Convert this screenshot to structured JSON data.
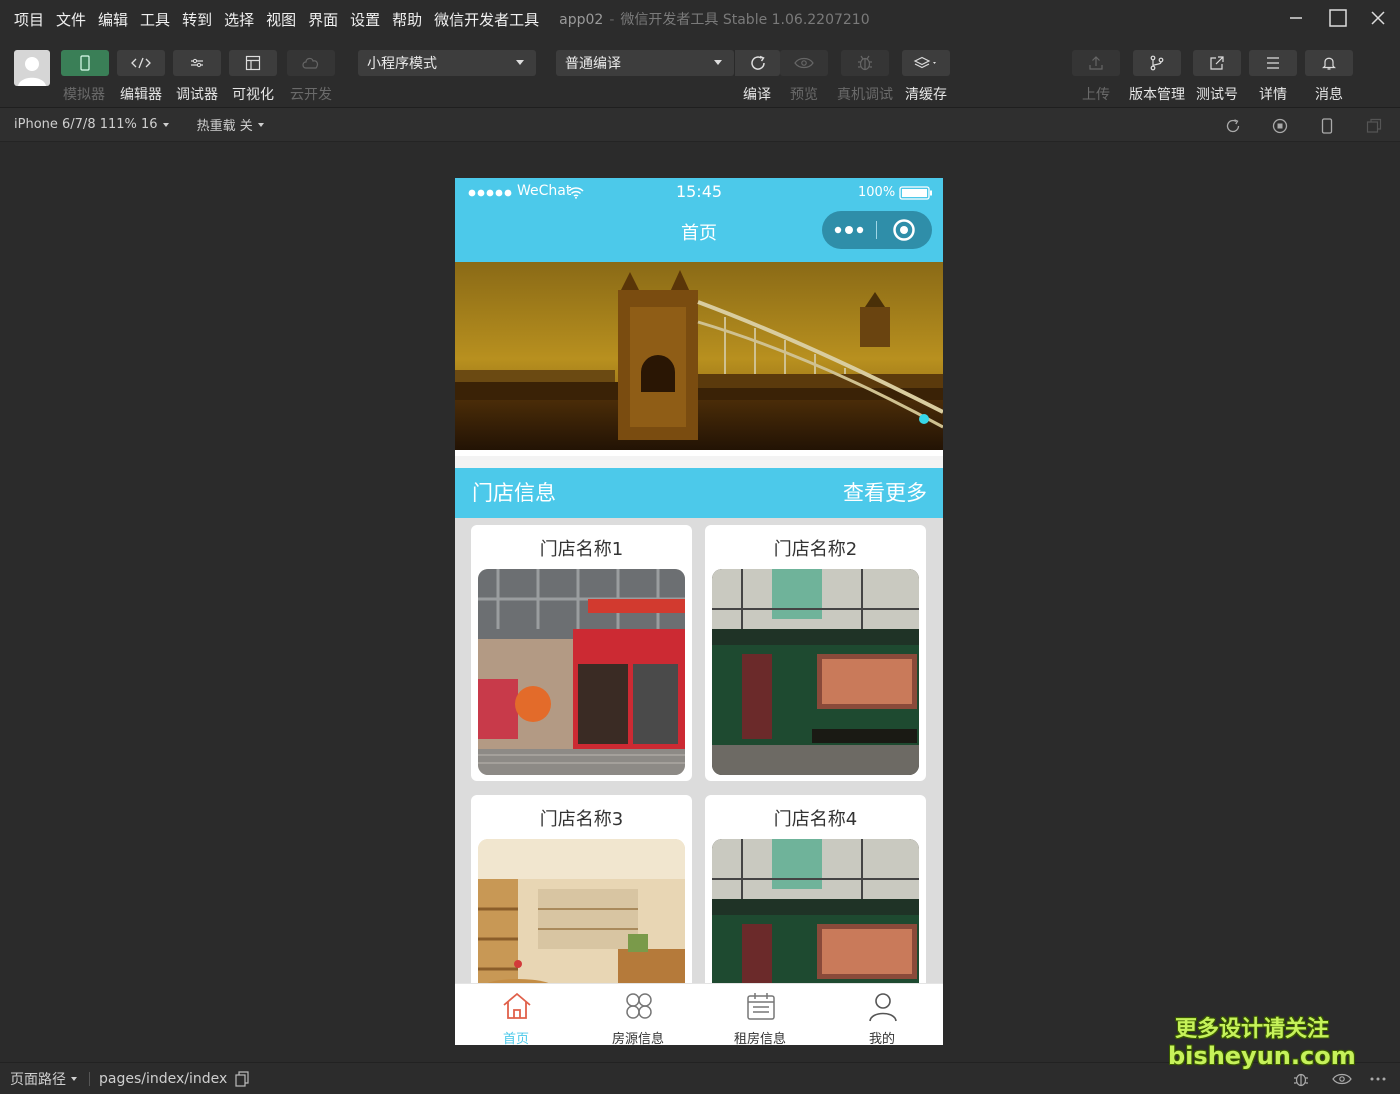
{
  "menu": [
    "项目",
    "文件",
    "编辑",
    "工具",
    "转到",
    "选择",
    "视图",
    "界面",
    "设置",
    "帮助",
    "微信开发者工具"
  ],
  "app_title": {
    "name": "app02",
    "separator": "-",
    "product": "微信开发者工具 Stable 1.06.2207210"
  },
  "toolbar": {
    "simulator_label": "模拟器",
    "editor_label": "编辑器",
    "debugger_label": "调试器",
    "visual_label": "可视化",
    "cloud_label": "云开发",
    "mode_select": "小程序模式",
    "compile_select": "普通编译",
    "compile_label": "编译",
    "preview_label": "预览",
    "remote_debug_label": "真机调试",
    "clear_cache_label": "清缓存",
    "upload_label": "上传",
    "version_label": "版本管理",
    "test_label": "测试号",
    "details_label": "详情",
    "messages_label": "消息"
  },
  "subbar": {
    "device": "iPhone 6/7/8 111% 16",
    "hot_reload": "热重载 关"
  },
  "phone": {
    "status": {
      "carrier": "WeChat",
      "time": "15:45",
      "battery": "100%"
    },
    "nav_title": "首页",
    "section": {
      "title": "门店信息",
      "more": "查看更多"
    },
    "stores": [
      {
        "name": "门店名称1"
      },
      {
        "name": "门店名称2"
      },
      {
        "name": "门店名称3"
      },
      {
        "name": "门店名称4"
      }
    ],
    "tabs": [
      {
        "label": "首页",
        "icon": "home-icon",
        "active": true
      },
      {
        "label": "房源信息",
        "icon": "grid-icon",
        "active": false
      },
      {
        "label": "租房信息",
        "icon": "calendar-icon",
        "active": false
      },
      {
        "label": "我的",
        "icon": "user-icon",
        "active": false
      }
    ]
  },
  "bottom": {
    "path_label": "页面路径",
    "path": "pages/index/index"
  },
  "watermark": {
    "line1": "更多设计请关注",
    "line2": "bisheyun.com"
  },
  "colors": {
    "accent": "#4cc9ea",
    "active_button": "#3a7f57",
    "background": "#2b2b2b"
  }
}
